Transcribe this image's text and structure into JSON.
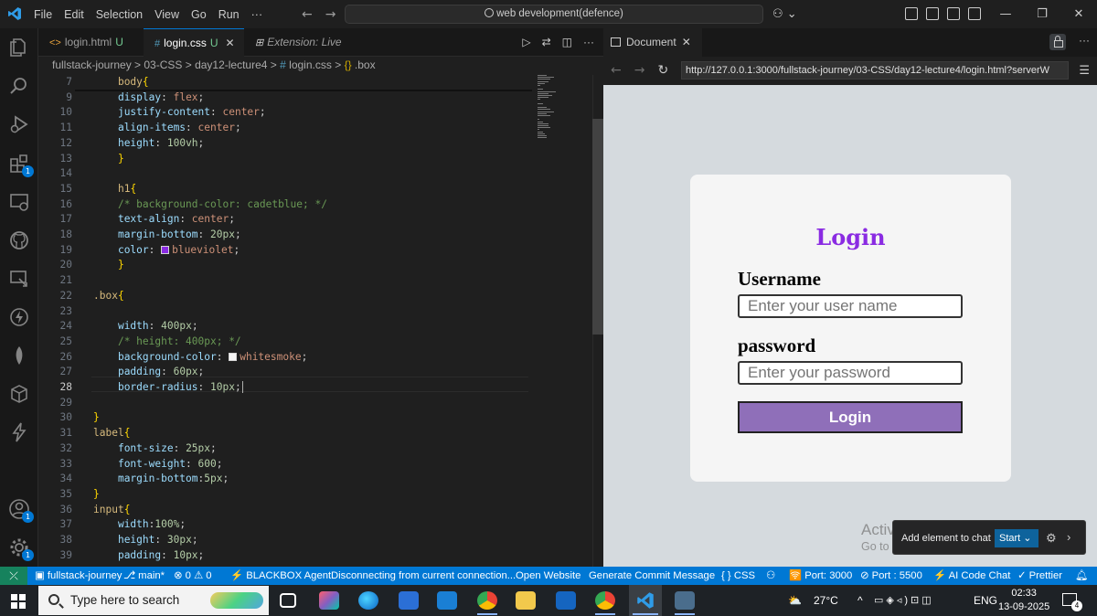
{
  "menu": [
    "File",
    "Edit",
    "Selection",
    "View",
    "Go",
    "Run",
    "···"
  ],
  "command_center": "web development(defence)",
  "tabs": [
    {
      "name": "login.html",
      "status": "U",
      "lang_icon": "<>"
    },
    {
      "name": "login.css",
      "status": "U",
      "lang_icon": "#",
      "close": "✕"
    },
    {
      "name": "Extension: Live Preview",
      "lang_icon": "⊞"
    }
  ],
  "breadcrumb": {
    "path": "fullstack-journey > 03-CSS > day12-lecture4 >",
    "file": "login.css",
    "separator": ">",
    "symbol": ".box"
  },
  "code_lines": [
    {
      "n": "7",
      "t": "    body{"
    },
    {
      "n": "9",
      "t": "    display: flex;"
    },
    {
      "n": "10",
      "t": "    justify-content: center;"
    },
    {
      "n": "11",
      "t": "    align-items: center;"
    },
    {
      "n": "12",
      "t": "    height: 100vh;"
    },
    {
      "n": "13",
      "t": "    }"
    },
    {
      "n": "14",
      "t": ""
    },
    {
      "n": "15",
      "t": "    h1{"
    },
    {
      "n": "16",
      "t": "    /* background-color: cadetblue; */"
    },
    {
      "n": "17",
      "t": "    text-align: center;"
    },
    {
      "n": "18",
      "t": "    margin-bottom: 20px;"
    },
    {
      "n": "19",
      "t": "    color: blueviolet;"
    },
    {
      "n": "20",
      "t": "    }"
    },
    {
      "n": "21",
      "t": ""
    },
    {
      "n": "22",
      "t": ".box{"
    },
    {
      "n": "23",
      "t": ""
    },
    {
      "n": "24",
      "t": "    width: 400px;"
    },
    {
      "n": "25",
      "t": "    /* height: 400px; */"
    },
    {
      "n": "26",
      "t": "    background-color: whitesmoke;"
    },
    {
      "n": "27",
      "t": "    padding: 60px;"
    },
    {
      "n": "28",
      "t": "    border-radius: 10px;"
    },
    {
      "n": "29",
      "t": ""
    },
    {
      "n": "30",
      "t": "}"
    },
    {
      "n": "31",
      "t": "label{"
    },
    {
      "n": "32",
      "t": "    font-size: 25px;"
    },
    {
      "n": "33",
      "t": "    font-weight: 600;"
    },
    {
      "n": "34",
      "t": "    margin-bottom:5px ;"
    },
    {
      "n": "35",
      "t": "}"
    },
    {
      "n": "36",
      "t": "input{"
    },
    {
      "n": "37",
      "t": "    width:100%;"
    },
    {
      "n": "38",
      "t": "    height: 30px;"
    },
    {
      "n": "39",
      "t": "    padding: 10px;"
    }
  ],
  "preview": {
    "tab_label": "Document",
    "url": "http://127.0.0.1:3000/fullstack-journey/03-CSS/day12-lecture4/login.html?serverW",
    "page": {
      "heading": "Login",
      "username_label": "Username",
      "username_placeholder": "Enter your user name",
      "password_label": "password",
      "password_placeholder": "Enter your password",
      "button": "Login"
    },
    "colors": {
      "heading": "#8a2be2",
      "button": "#8f6fb9",
      "box": "#f5f5f5"
    }
  },
  "activate_windows": {
    "line1": "Activate Windows",
    "line2": "Go to Settings to activate Windows."
  },
  "chat_popup": {
    "text": "Add element to chat",
    "button": "Start"
  },
  "status_bar": {
    "branch_repo": "fullstack-journey",
    "branch": "main*",
    "problems": "⊗ 0 ⚠ 0",
    "blackbox": "⚡ BLACKBOX Agent",
    "connection": "Disconnecting from current connection...",
    "open_website": "Open Website",
    "commit": "Generate Commit Message",
    "language": "{ } CSS",
    "port": "🛜 Port: 3000",
    "port2": "⊘ Port : 5500",
    "ai_chat": "⚡ AI Code Chat",
    "prettier": "✓ Prettier"
  },
  "taskbar": {
    "search_placeholder": "Type here to search",
    "temperature": "27°C",
    "language": "ENG",
    "time": "02:33",
    "date": "13-09-2025",
    "notifications": "4"
  }
}
